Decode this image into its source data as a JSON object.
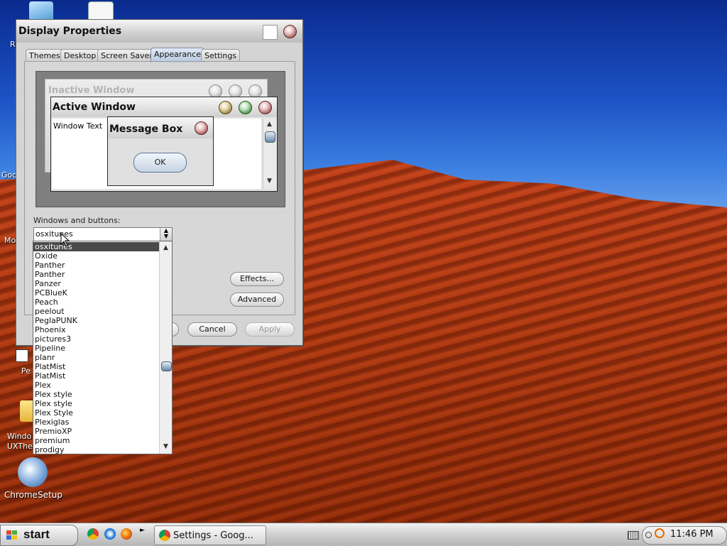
{
  "desktop": {
    "icons": [
      {
        "label": "R"
      },
      {
        "label": "Goo"
      },
      {
        "label": "Mo"
      },
      {
        "label": "Pe"
      },
      {
        "label": "Windo\nUXThe"
      },
      {
        "label": "ChromeSetup"
      }
    ]
  },
  "dialog": {
    "title": "Display Properties",
    "tabs": [
      "Themes",
      "Desktop",
      "Screen Saver",
      "Appearance",
      "Settings"
    ],
    "active_tab": "Appearance",
    "preview": {
      "inactive_title": "Inactive Window",
      "active_title": "Active Window",
      "window_text": "Window Text",
      "message_box_title": "Message Box",
      "ok_label": "OK"
    },
    "windows_buttons_label": "Windows and buttons:",
    "windows_buttons_value": "osxitunes",
    "effects_label": "Effects...",
    "advanced_label": "Advanced",
    "cancel_label": "Cancel",
    "apply_label": "Apply"
  },
  "dropdown": {
    "selected": "osxitunes",
    "items": [
      "osxitunes",
      "Oxide",
      "Panther",
      "Panther",
      "Panzer",
      "PCBlueK",
      "Peach",
      "peelout",
      "PeglaPUNK",
      "Phoenix",
      "pictures3",
      "Pipeline",
      "planr",
      "PlatMist",
      "PlatMist",
      "Plex",
      "Plex style",
      "Plex style",
      "Plex Style",
      "Plexiglas",
      "PremioXP",
      "premium",
      "prodigy"
    ]
  },
  "taskbar": {
    "start_label": "start",
    "quicklaunch": [
      "chrome-icon",
      "internet-explorer-icon",
      "firefox-icon"
    ],
    "task_label": "Settings - Goog...",
    "clock": "11:46 PM"
  },
  "colors": {
    "selection": "#4a4a4a",
    "dune": "#b13a12",
    "sky": "#1d52c4"
  }
}
